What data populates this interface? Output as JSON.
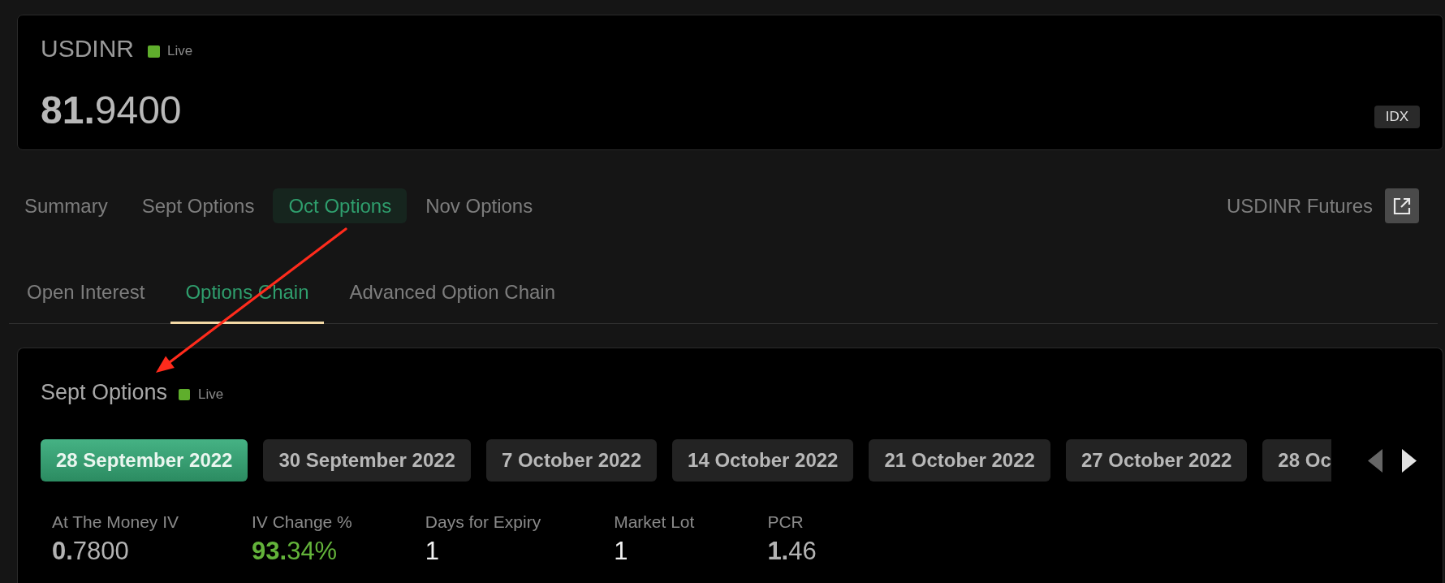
{
  "instrument": {
    "symbol": "USDINR",
    "status": "Live",
    "price": "**81.**9400",
    "type_tag": "IDX"
  },
  "nav": {
    "tabs": [
      {
        "label": "Summary",
        "selected": false
      },
      {
        "label": "Sept Options",
        "selected": false
      },
      {
        "label": "Oct Options",
        "selected": true
      },
      {
        "label": "Nov Options",
        "selected": false
      }
    ],
    "futures_link": "USDINR Futures"
  },
  "subtabs": [
    {
      "label": "Open Interest",
      "selected": false
    },
    {
      "label": "Options Chain",
      "selected": true
    },
    {
      "label": "Advanced Option Chain",
      "selected": false
    }
  ],
  "options_panel": {
    "title": "Sept Options",
    "status": "Live",
    "expiries": [
      {
        "label": "28 September 2022",
        "selected": true
      },
      {
        "label": "30 September 2022",
        "selected": false
      },
      {
        "label": "7 October 2022",
        "selected": false
      },
      {
        "label": "14 October 2022",
        "selected": false
      },
      {
        "label": "21 October 2022",
        "selected": false
      },
      {
        "label": "27 October 2022",
        "selected": false
      },
      {
        "label": "28 Oc",
        "selected": false
      }
    ],
    "scroll_prev": {
      "disabled": true
    },
    "scroll_next": {
      "disabled": false
    },
    "stats": [
      {
        "label": "At The Money IV",
        "value": "**0.**7800",
        "color": "#b3b3b3"
      },
      {
        "label": "IV Change %",
        "value": "**93.**34%",
        "color": "#63b33a"
      },
      {
        "label": "Days for Expiry",
        "value": "1",
        "color": "#f2f2f2"
      },
      {
        "label": "Market Lot",
        "value": "1",
        "color": "#f2f2f2"
      },
      {
        "label": "PCR",
        "value": "**1.**46",
        "color": "#b3b3b3"
      }
    ]
  }
}
